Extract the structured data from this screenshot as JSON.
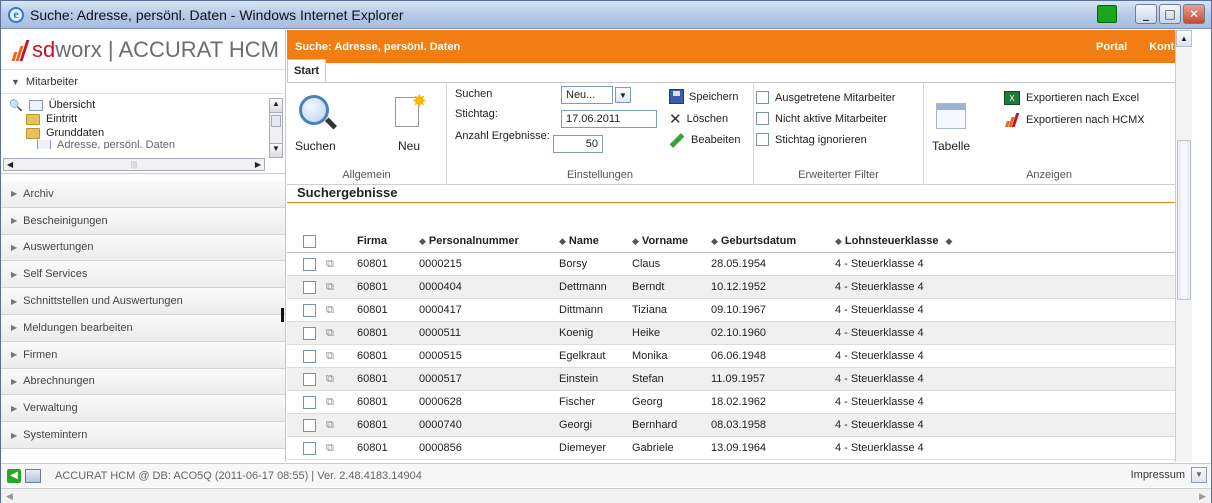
{
  "window": {
    "title": "Suche: Adresse, persönl. Daten - Windows Internet Explorer"
  },
  "logo": {
    "brand_sd": "sd",
    "brand_worx": "worx",
    "product": "| ACCURAT HCM"
  },
  "sidebar": {
    "section_label": "Mitarbeiter",
    "tree": [
      "Übersicht",
      "Eintritt",
      "Grunddaten",
      "Adresse, persönl. Daten"
    ],
    "nav": [
      "Archiv",
      "Bescheinigungen",
      "Auswertungen",
      "Self Services",
      "Schnittstellen und Auswertungen",
      "Meldungen bearbeiten",
      "Firmen",
      "Abrechnungen",
      "Verwaltung",
      "Systemintern"
    ]
  },
  "header": {
    "title": "Suche: Adresse, persönl. Daten",
    "portal": "Portal",
    "konto": "Konto"
  },
  "tabs": [
    "Start"
  ],
  "ribbon": {
    "allgemein": {
      "label": "Allgemein",
      "suchen": "Suchen",
      "neu": "Neu"
    },
    "einstellungen": {
      "label": "Einstellungen",
      "suchen_label": "Suchen",
      "suchen_value": "Neu...",
      "stichtag_label": "Stichtag:",
      "stichtag_value": "17.06.2011",
      "anzahl_label": "Anzahl Ergebnisse:",
      "anzahl_value": "50",
      "speichern": "Speichern",
      "loeschen": "Löschen",
      "bearbeiten": "Beabeiten"
    },
    "filter": {
      "label": "Erweiterter Filter",
      "opt1": "Ausgetretene Mitarbeiter",
      "opt2": "Nicht aktive Mitarbeiter",
      "opt3": "Stichtag ignorieren"
    },
    "anzeigen": {
      "label": "Anzeigen",
      "tabelle": "Tabelle",
      "excel": "Exportieren nach Excel",
      "hcmx": "Exportieren nach HCMX"
    }
  },
  "results": {
    "title": "Suchergebnisse",
    "columns": [
      "Firma",
      "Personalnummer",
      "Name",
      "Vorname",
      "Geburtsdatum",
      "Lohnsteuerklasse"
    ],
    "rows": [
      [
        "60801",
        "0000215",
        "Borsy",
        "Claus",
        "28.05.1954",
        "4 - Steuerklasse 4"
      ],
      [
        "60801",
        "0000404",
        "Dettmann",
        "Berndt",
        "10.12.1952",
        "4 - Steuerklasse 4"
      ],
      [
        "60801",
        "0000417",
        "Dittmann",
        "Tiziana",
        "09.10.1967",
        "4 - Steuerklasse 4"
      ],
      [
        "60801",
        "0000511",
        "Koenig",
        "Heike",
        "02.10.1960",
        "4 - Steuerklasse 4"
      ],
      [
        "60801",
        "0000515",
        "Egelkraut",
        "Monika",
        "06.06.1948",
        "4 - Steuerklasse 4"
      ],
      [
        "60801",
        "0000517",
        "Einstein",
        "Stefan",
        "11.09.1957",
        "4 - Steuerklasse 4"
      ],
      [
        "60801",
        "0000628",
        "Fischer",
        "Georg",
        "18.02.1962",
        "4 - Steuerklasse 4"
      ],
      [
        "60801",
        "0000740",
        "Georgi",
        "Bernhard",
        "08.03.1958",
        "4 - Steuerklasse 4"
      ],
      [
        "60801",
        "0000856",
        "Diemeyer",
        "Gabriele",
        "13.09.1964",
        "4 - Steuerklasse 4"
      ]
    ]
  },
  "status": {
    "text": "ACCURAT HCM @ DB: ACO5Q (2011-06-17 08:55) | Ver. 2.48.4183.14904",
    "impressum": "Impressum"
  }
}
